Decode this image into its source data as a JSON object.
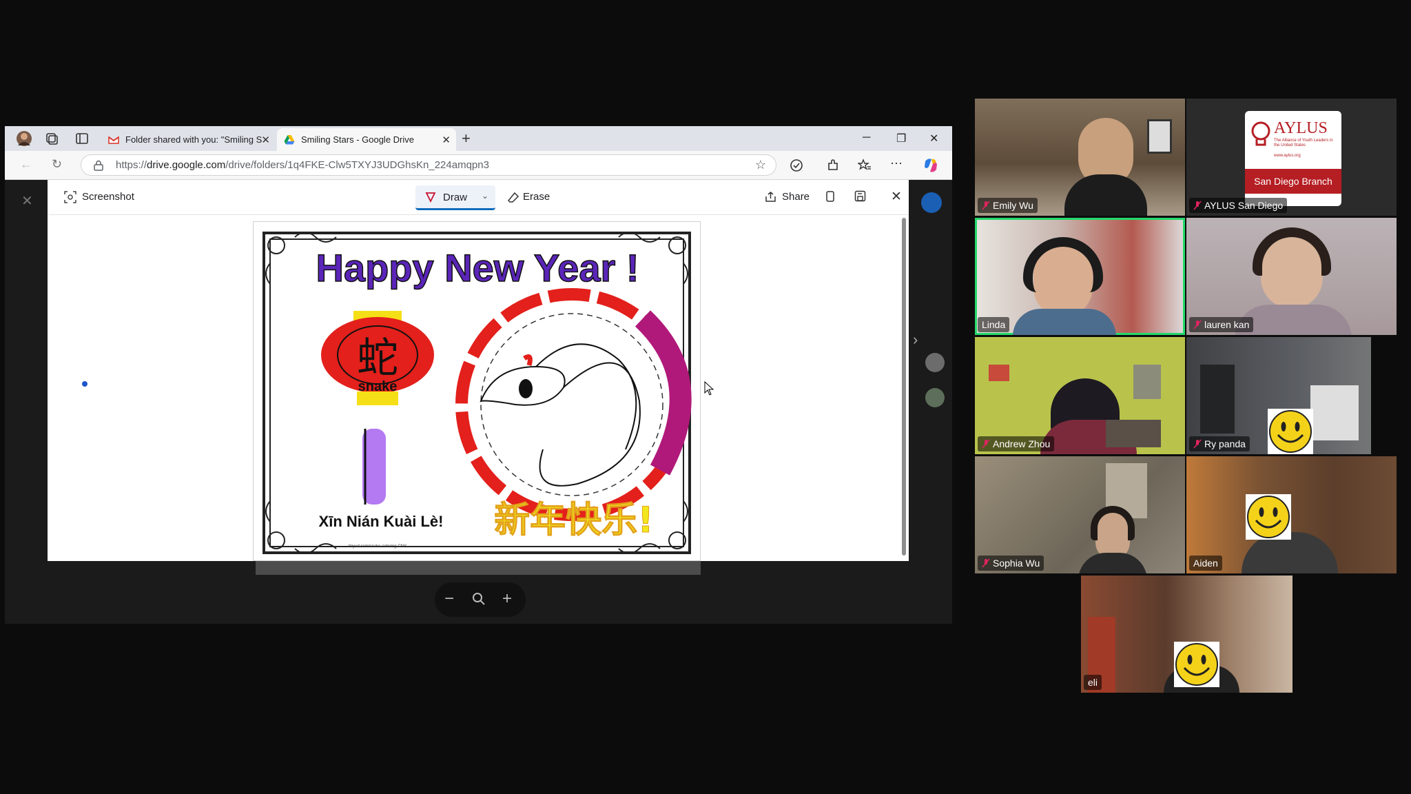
{
  "browser": {
    "tabs": [
      {
        "label": "Folder shared with you: \"Smiling S",
        "favicon": "gmail-icon"
      },
      {
        "label": "Smiling Stars - Google Drive",
        "favicon": "google-drive-icon"
      }
    ],
    "url_prefix": "https://",
    "url_domain": "drive.google.com",
    "url_path": "/drive/folders/1q4FKE-Clw5TXYJ3UDGhsKn_224amqpn3"
  },
  "screenshot_tool": {
    "title": "Screenshot",
    "draw_label": "Draw",
    "erase_label": "Erase",
    "share_label": "Share"
  },
  "poster": {
    "headline": "Happy New Year !",
    "lantern_char": "蛇",
    "lantern_label": "snake",
    "pinyin": "Xīn Nián Kuài Lè!",
    "chinese": "新年快乐!",
    "credit": "tinyurl.com/snake-coloring-CNY"
  },
  "participants": [
    {
      "name": "Emily Wu",
      "muted": true
    },
    {
      "name": "AYLUS San Diego",
      "muted": true
    },
    {
      "name": "Linda",
      "muted": false,
      "speaking": true
    },
    {
      "name": "lauren kan",
      "muted": true
    },
    {
      "name": "Andrew Zhou",
      "muted": true
    },
    {
      "name": "Ry panda",
      "muted": true
    },
    {
      "name": "Sophia Wu",
      "muted": true
    },
    {
      "name": "Aiden",
      "muted": false
    },
    {
      "name": "eli",
      "muted": false
    }
  ],
  "aylus_logo": {
    "title": "AYLUS",
    "tagline": "The Alliance of Youth Leaders in the United States",
    "url": "www.aylus.org",
    "branch": "San Diego Branch"
  },
  "colors": {
    "speaking_outline": "#23d96b",
    "muted_icon": "#e0245e",
    "aylus_red": "#b51e23"
  }
}
